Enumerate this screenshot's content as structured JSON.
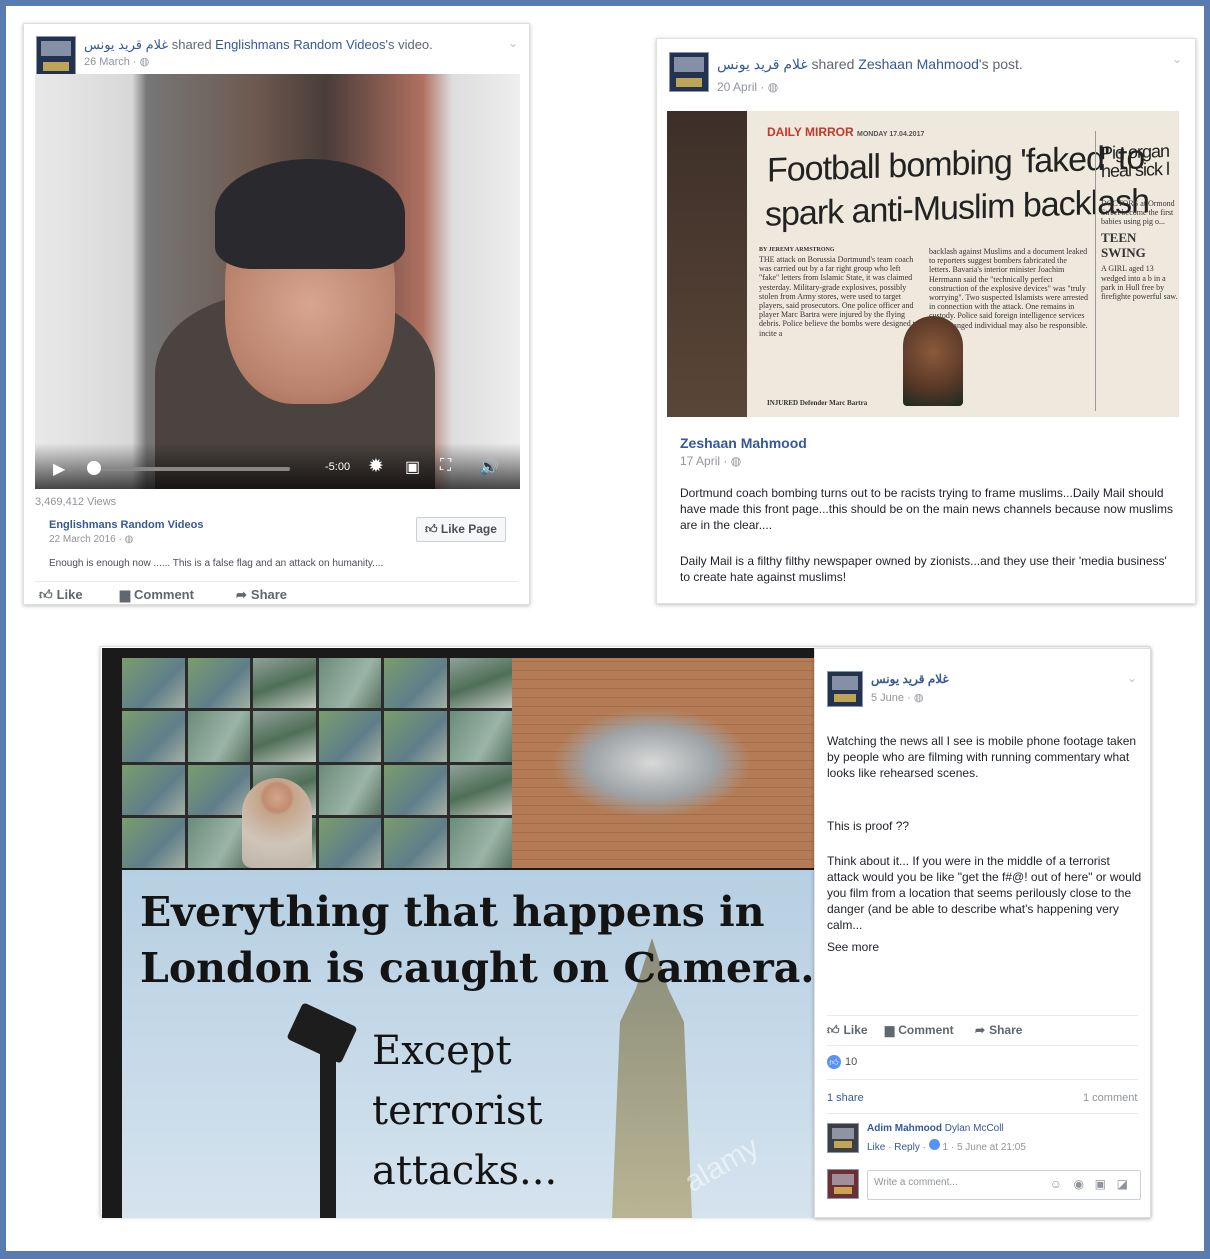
{
  "post1": {
    "author": "غلام قريد يونس",
    "shared_text": " shared ",
    "shared_source": "Englishmans Random Videos",
    "shared_suffix": "'s video.",
    "date": "26 March · ",
    "video": {
      "time": "-5:00"
    },
    "views": "3,469,412 Views",
    "source_name": "Englishmans Random Videos",
    "source_date": "22 March 2016 · ",
    "like_page": "Like Page",
    "caption": "Enough is enough now ...... This is a false flag and an attack on humanity....",
    "actions": {
      "like": "Like",
      "comment": "Comment",
      "share": "Share"
    }
  },
  "post2": {
    "author": "غلام قريد يونس",
    "shared_text": " shared ",
    "shared_source": "Zeshaan Mahmood",
    "shared_suffix": "'s post.",
    "date": "20 April · ",
    "newspaper": {
      "masthead": "DAILY MIRROR",
      "dateline": "MONDAY 17.04.2017",
      "headline_line1": "Football bombing 'faked' to",
      "headline_line2": "spark anti-Muslim backlash",
      "side_headline": "Pig organ",
      "side_headline2": "heal sick l",
      "byline": "BY JEREMY ARMSTRONG",
      "body": "THE attack on Borussia Dortmund's team coach was carried out by a far right group who left \"fake\" letters from Islamic State, it was claimed yesterday. Military-grade explosives, possibly stolen from Army stores, were used to target players, said prosecutors. One police officer and player Marc Bartra were injured by the flying debris. Police believe the bombs were designed to incite a",
      "body2": "backlash against Muslims and a document leaked to reporters suggest bombers fabricated the letters. Bavaria's interior minister Joachim Herrmann said the \"technically perfect construction of the explosive devices\" was \"truly worrying\". Two suspected Islamists were arrested in connection with the attack. One remains in custody. Police said foreign intelligence services or a deranged individual may also be responsible.",
      "photo_caption": "INJURED Defender Marc Bartra",
      "side_sub": "TEEN SWING"
    },
    "inner_author": "Zeshaan Mahmood",
    "inner_date": "17 April · ",
    "text1": "Dortmund coach bombing turns out to be racists trying to frame muslims...Daily Mail should have made this front page...this should be on the main news channels because now muslims are in the clear....",
    "text2": "Daily Mail is a filthy filthy newspaper owned by zionists...and they use their 'media business' to create hate against muslims!"
  },
  "post3": {
    "image_line1": "Everything that happens in",
    "image_line2": "London is caught on Camera.",
    "image_line3": "Except",
    "image_line4": "terrorist",
    "image_line5": "attacks...",
    "watermark": "alamy",
    "author": "غلام قريد يونس",
    "date": "5 June · ",
    "para1": "Watching the news all I see is mobile phone footage taken by people who are filming with running commentary what looks like rehearsed scenes.",
    "para2": "This is proof ??",
    "para3": "Think about it... If you were in the middle of a terrorist attack would you be like \"get the f#@! out of here\" or would you film from a location that seems perilously close to the danger (and be able to describe what's happening very calm...",
    "see_more": "See more",
    "actions": {
      "like": "Like",
      "comment": "Comment",
      "share": "Share"
    },
    "reactions": "10",
    "shares": "1 share",
    "comments_count": "1 comment",
    "comment_author": "Adim Mahmood",
    "comment_tag": " Dylan McColl",
    "comment_meta_like": "Like",
    "comment_meta_reply": "Reply",
    "comment_meta_rest": " 1 · 5 June at 21:05",
    "write_comment": "Write a comment..."
  },
  "colors": {
    "fb_link": "#365899",
    "frame": "#5a7bb0",
    "like_blue": "#5890ff"
  }
}
